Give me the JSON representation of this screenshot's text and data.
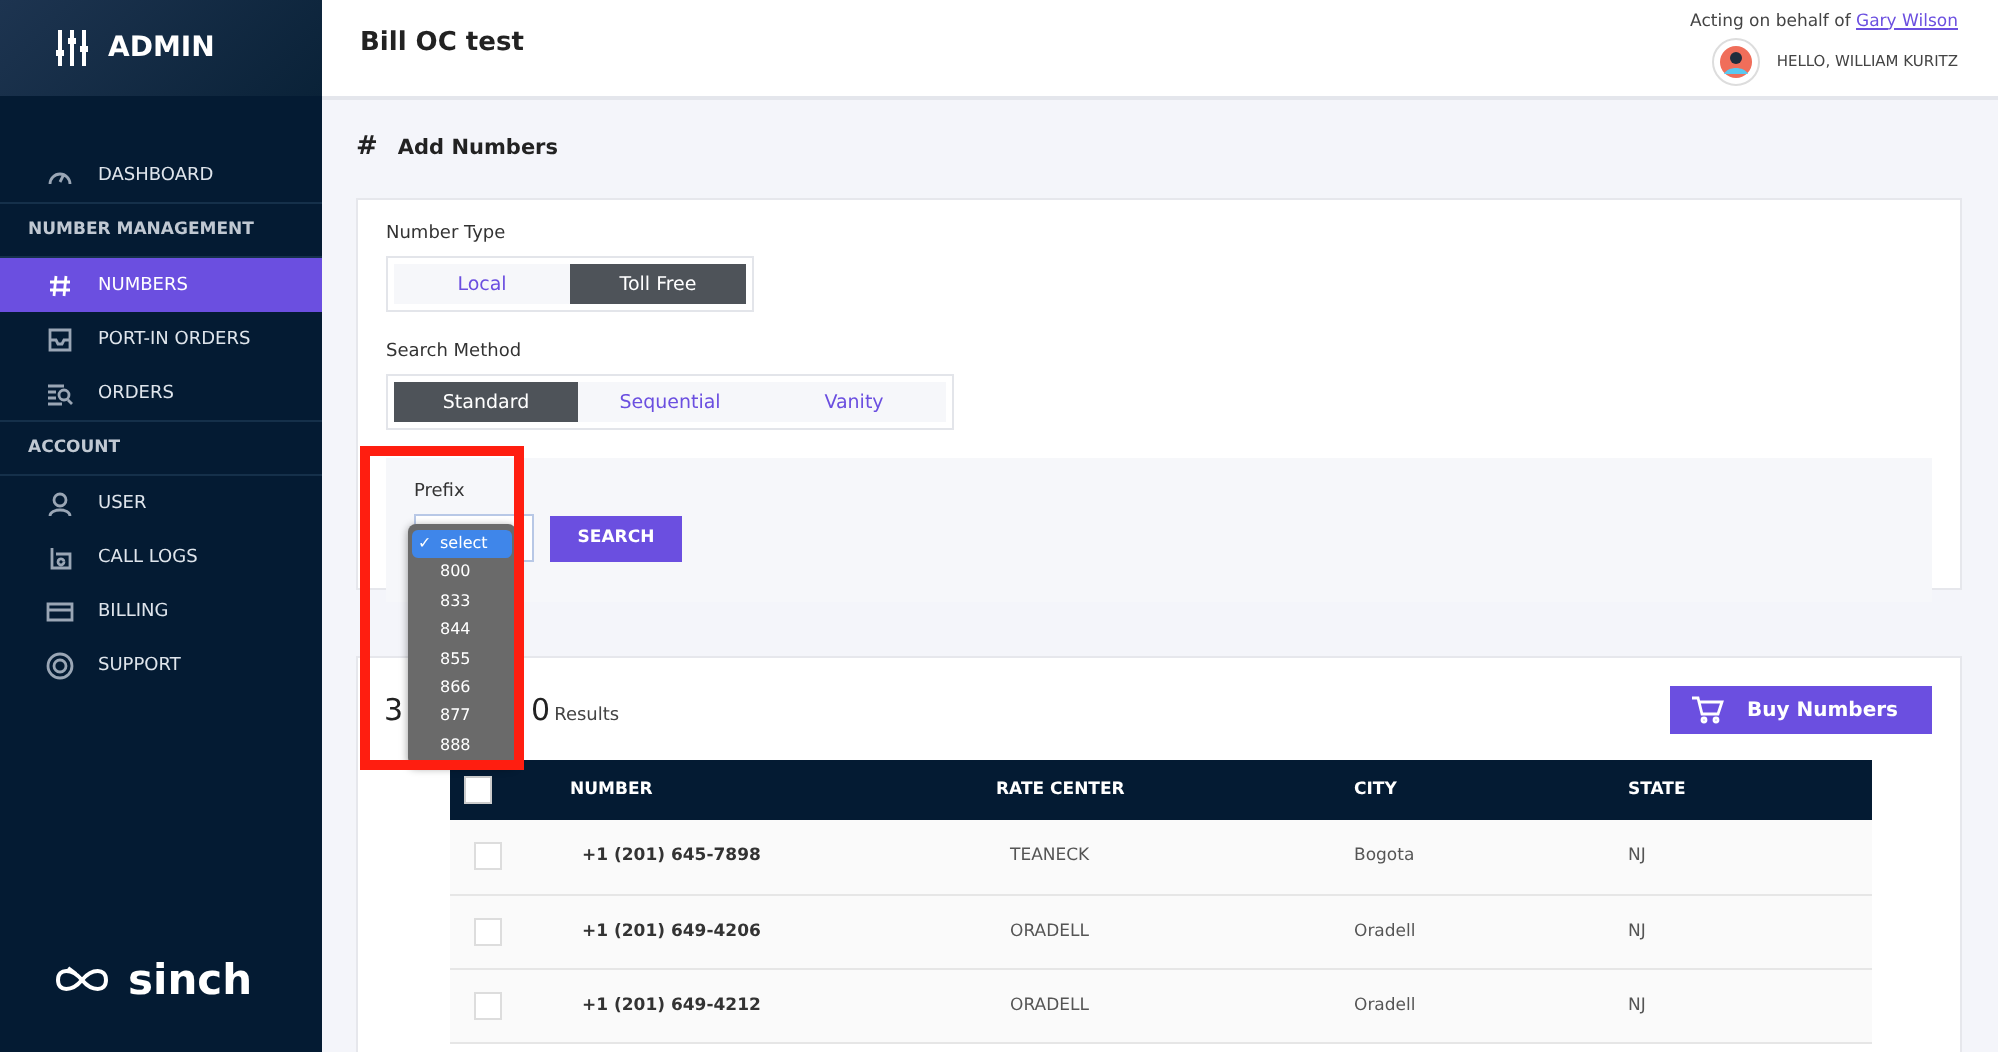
{
  "sidebar": {
    "brand": "ADMIN",
    "logo_text": "sinch",
    "nav": [
      {
        "kind": "item",
        "label": "DASHBOARD",
        "selected": false
      },
      {
        "kind": "heading",
        "label": "NUMBER MANAGEMENT"
      },
      {
        "kind": "item",
        "label": "NUMBERS",
        "selected": true
      },
      {
        "kind": "item",
        "label": "PORT-IN ORDERS",
        "selected": false
      },
      {
        "kind": "item",
        "label": "ORDERS",
        "selected": false
      },
      {
        "kind": "heading",
        "label": "ACCOUNT"
      },
      {
        "kind": "item",
        "label": "USER",
        "selected": false
      },
      {
        "kind": "item",
        "label": "CALL LOGS",
        "selected": false
      },
      {
        "kind": "item",
        "label": "BILLING",
        "selected": false
      },
      {
        "kind": "item",
        "label": "SUPPORT",
        "selected": false
      }
    ]
  },
  "header": {
    "title": "Bill OC test",
    "acting_prefix": "Acting on behalf of",
    "acting_user": "Gary Wilson",
    "greeting": "HELLO, WILLIAM KURITZ"
  },
  "page_title_icon": "#",
  "page_title": "Add Numbers",
  "number_type": {
    "label": "Number Type",
    "options": [
      {
        "label": "Local",
        "selected": false
      },
      {
        "label": "Toll Free",
        "selected": true
      }
    ]
  },
  "search_method": {
    "label": "Search Method",
    "options": [
      {
        "label": "Standard",
        "selected": true
      },
      {
        "label": "Sequential",
        "selected": false
      },
      {
        "label": "Vanity",
        "selected": false
      }
    ]
  },
  "prefix": {
    "label": "Prefix",
    "button": "SEARCH",
    "check_mark": "✓",
    "options": [
      {
        "label": "select",
        "selected": true
      },
      {
        "label": "800",
        "selected": false
      },
      {
        "label": "833",
        "selected": false
      },
      {
        "label": "844",
        "selected": false
      },
      {
        "label": "855",
        "selected": false
      },
      {
        "label": "866",
        "selected": false
      },
      {
        "label": "877",
        "selected": false
      },
      {
        "label": "888",
        "selected": false
      }
    ]
  },
  "results": {
    "count_start": "3",
    "count_end": "0",
    "label": "Results",
    "buy_button": "Buy Numbers"
  },
  "table": {
    "select_all_checked": false,
    "columns": [
      "NUMBER",
      "RATE CENTER",
      "CITY",
      "STATE"
    ],
    "rows": [
      {
        "checked": false,
        "cells": [
          "+1 (201) 645-7898",
          "TEANECK",
          "Bogota",
          "NJ"
        ]
      },
      {
        "checked": false,
        "cells": [
          "+1 (201) 649-4206",
          "ORADELL",
          "Oradell",
          "NJ"
        ]
      },
      {
        "checked": false,
        "cells": [
          "+1 (201) 649-4212",
          "ORADELL",
          "Oradell",
          "NJ"
        ]
      }
    ]
  }
}
